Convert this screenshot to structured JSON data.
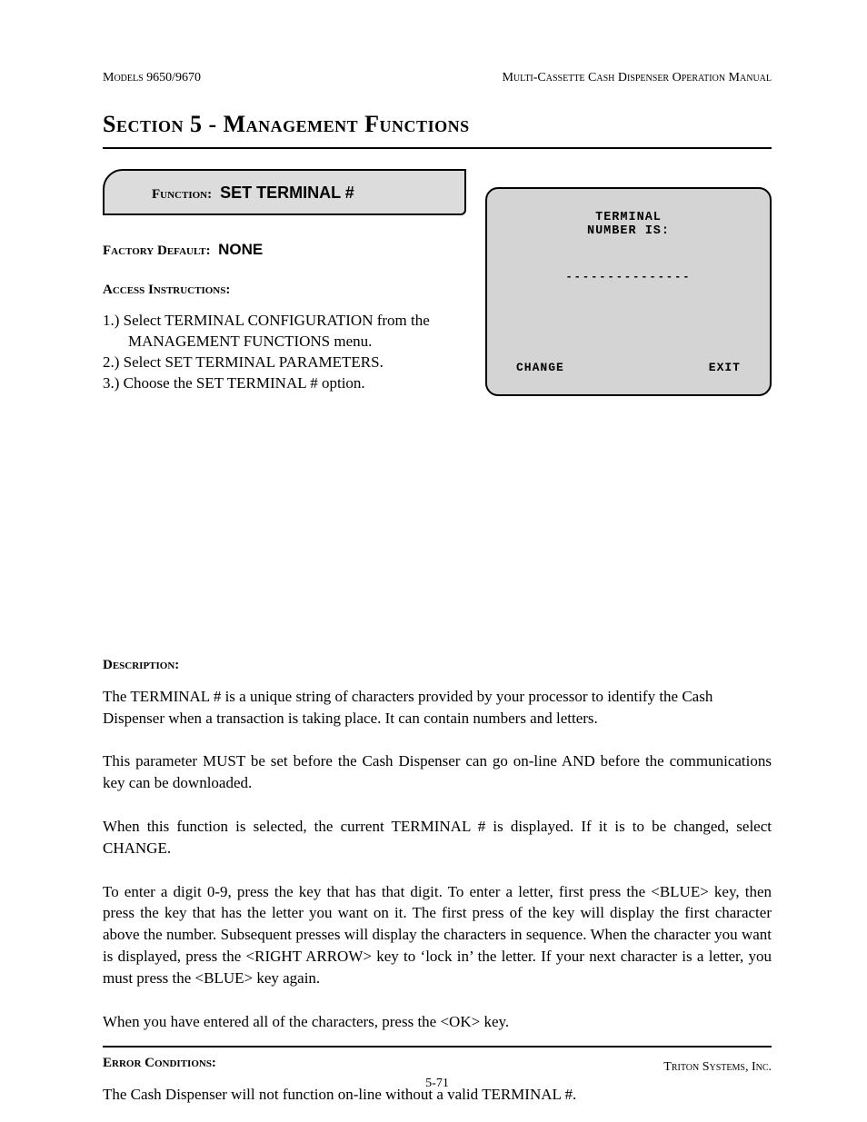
{
  "header": {
    "left": "Models 9650/9670",
    "right": "Multi-Cassette Cash Dispenser Operation Manual"
  },
  "section_title": "Section 5 - Management Functions",
  "function": {
    "label": "Function:",
    "name": "SET TERMINAL #"
  },
  "factory_default": {
    "label": "Factory Default:",
    "value": "NONE"
  },
  "access": {
    "label": "Access Instructions:",
    "steps": [
      "1.)  Select TERMINAL CONFIGURATION from the MANAGEMENT FUNCTIONS menu.",
      "2.)  Select SET TERMINAL PARAMETERS.",
      "3.)  Choose the SET TERMINAL # option."
    ]
  },
  "screen": {
    "line1": "TERMINAL",
    "line2": "NUMBER IS:",
    "dashes": "---------------",
    "btn_left": "CHANGE",
    "btn_right": "EXIT"
  },
  "description": {
    "label": "Description:",
    "paragraphs": [
      "The TERMINAL # is a unique string of characters provided by your processor to identify the Cash Dispenser when a transaction is taking place.  It can contain numbers and letters.",
      "This parameter MUST be set before the Cash Dispenser can go on-line AND before the communications key can be downloaded.",
      "When this function is selected, the current TERMINAL # is displayed.  If it is to be changed, select CHANGE.",
      "To enter a digit 0-9, press the key that has that digit.  To enter a letter, first press the <BLUE> key, then press the key that has the letter you want on it.  The first press of the key will display the first character above the number.  Subsequent presses will display the characters in sequence.  When the character you want is displayed, press the <RIGHT ARROW> key to ‘lock in’ the letter.  If your next character is a letter, you must press the <BLUE> key again.",
      "When you have entered all of the characters, press the <OK> key."
    ]
  },
  "error_conditions": {
    "label": "Error Conditions:",
    "text": "The Cash Dispenser will not function on-line without a valid TERMINAL #."
  },
  "footer": {
    "company": "Triton Systems, Inc.",
    "page": "5-71"
  }
}
